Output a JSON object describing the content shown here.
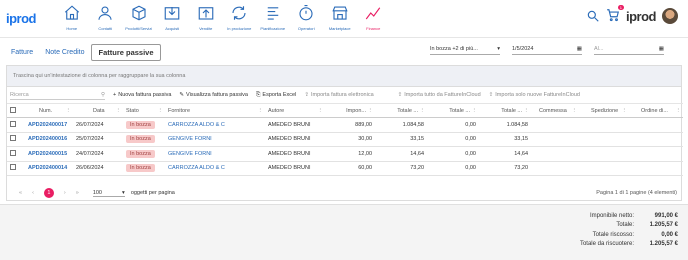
{
  "brand": {
    "logo": "iprod",
    "logo_right": "iprod",
    "cart_count": "1"
  },
  "nav": [
    {
      "label": "Home",
      "icon": "home-icon"
    },
    {
      "label": "Contatti",
      "icon": "user-icon"
    },
    {
      "label": "Prodotti/Servizi",
      "icon": "box-icon"
    },
    {
      "label": "Acquisti",
      "icon": "inbox-icon"
    },
    {
      "label": "Vendite",
      "icon": "outbox-icon"
    },
    {
      "label": "In produzione",
      "icon": "refresh-icon"
    },
    {
      "label": "Pianificazione",
      "icon": "list-icon"
    },
    {
      "label": "Operatori",
      "icon": "stopwatch-icon"
    },
    {
      "label": "Marketplace",
      "icon": "store-icon"
    },
    {
      "label": "Finance",
      "icon": "chart-line-icon"
    }
  ],
  "tabs": [
    "Fatture",
    "Note Credito",
    "Fatture passive"
  ],
  "filters": {
    "status": "In bozza  +2 di più...",
    "date_from": "1/5/2024",
    "date_to_placeholder": "Al..."
  },
  "grouping_hint": "Trascina qui un'intestazione di colonna per raggruppare la sua colonna",
  "toolbar": {
    "search_placeholder": "Ricerca",
    "new_label": "Nuova fattura passiva",
    "view_label": "Visualizza fattura passiva",
    "export_label": "Esporta Excel",
    "import_e_label": "Importa fattura elettronica",
    "import_all_label": "Importa tutto da FattureInCloud",
    "import_new_label": "Importa solo nuove FattureInCloud"
  },
  "columns": [
    "Num.",
    "Data",
    "Stato",
    "Fornitore",
    "Autore",
    "Impon...",
    "Totale ...",
    "Totale ...",
    "Totale ...",
    "Commessa",
    "Spedizione",
    "Ordine di..."
  ],
  "rows": [
    {
      "num": "APD202400017",
      "data": "26/07/2024",
      "stato": "In bozza",
      "fornitore": "CARROZZA ALDO & C",
      "autore": "AMEDEO BRUNI",
      "impon": "889,00",
      "tot1": "1.084,58",
      "tot2": "0,00",
      "tot3": "1.084,58"
    },
    {
      "num": "APD202400016",
      "data": "25/07/2024",
      "stato": "In bozza",
      "fornitore": "GENGIVE FORNI",
      "autore": "AMEDEO BRUNI",
      "impon": "30,00",
      "tot1": "33,15",
      "tot2": "0,00",
      "tot3": "33,15"
    },
    {
      "num": "APD202400015",
      "data": "24/07/2024",
      "stato": "In bozza",
      "fornitore": "GENGIVE FORNI",
      "autore": "AMEDEO BRUNI",
      "impon": "12,00",
      "tot1": "14,64",
      "tot2": "0,00",
      "tot3": "14,64"
    },
    {
      "num": "APD202400014",
      "data": "26/06/2024",
      "stato": "In bozza",
      "fornitore": "CARROZZA ALDO & C",
      "autore": "AMEDEO BRUNI",
      "impon": "60,00",
      "tot1": "73,20",
      "tot2": "0,00",
      "tot3": "73,20"
    }
  ],
  "pager": {
    "current": "1",
    "page_size": "100",
    "page_size_label": "oggetti per pagina",
    "info": "Pagina 1 di 1 pagine (4 elementi)"
  },
  "totals": [
    {
      "label": "Imponibile netto:",
      "value": "991,00 €"
    },
    {
      "label": "Totale:",
      "value": "1.205,57 €"
    },
    {
      "label": "Totale riscosso:",
      "value": "0,00 €"
    },
    {
      "label": "Totale da riscuotere:",
      "value": "1.205,57 €"
    }
  ]
}
